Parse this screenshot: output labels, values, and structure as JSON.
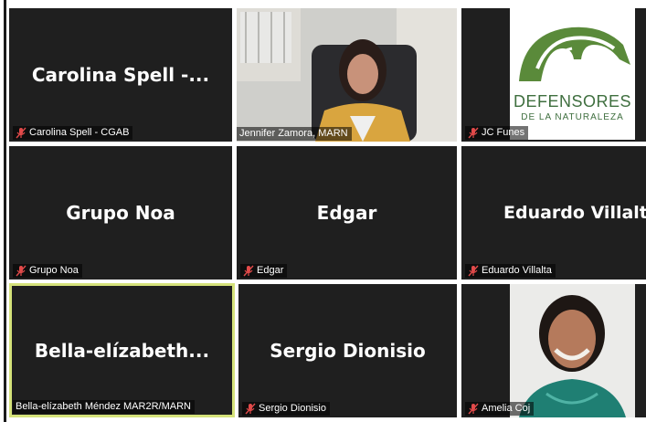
{
  "colors": {
    "tile_bg": "#1f1f1f",
    "active_border": "#d5e27a",
    "mic_muted": "#e24a4a",
    "logo_green": "#3f6f3f"
  },
  "tiles": [
    {
      "display_name": "Carolina Spell -...",
      "label": "Carolina Spell - CGAB",
      "muted": true,
      "type": "name"
    },
    {
      "display_name": "",
      "label": "Jennifer Zamora, MARN",
      "muted": false,
      "type": "video"
    },
    {
      "display_name": "",
      "label": "JC Funes",
      "muted": true,
      "type": "logo"
    },
    {
      "display_name": "Grupo Noa",
      "label": "Grupo Noa",
      "muted": true,
      "type": "name"
    },
    {
      "display_name": "Edgar",
      "label": "Edgar",
      "muted": true,
      "type": "name"
    },
    {
      "display_name": "Eduardo Villalta",
      "label": "Eduardo Villalta",
      "muted": true,
      "type": "name"
    },
    {
      "display_name": "Bella-elízabeth...",
      "label": "Bella-elízabeth Méndez MAR2R/MARN",
      "muted": false,
      "type": "name",
      "active": true
    },
    {
      "display_name": "Sergio Dionisio",
      "label": "Sergio Dionisio",
      "muted": true,
      "type": "name"
    },
    {
      "display_name": "",
      "label": "Amelia Coj",
      "muted": true,
      "type": "photo"
    }
  ],
  "logo": {
    "line1": "DEFENSORES",
    "line2": "DE LA NATURALEZA"
  },
  "icons": {
    "muted_mic": "mic-off-icon"
  }
}
